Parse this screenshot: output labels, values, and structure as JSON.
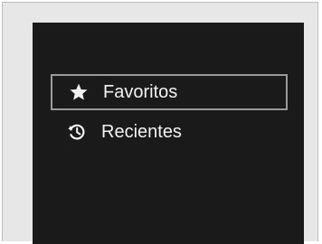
{
  "menu": {
    "items": [
      {
        "label": "Favoritos",
        "icon": "star-icon",
        "selected": true
      },
      {
        "label": "Recientes",
        "icon": "history-clock-icon",
        "selected": false
      }
    ]
  },
  "colors": {
    "screen_background": "#1a1a1a",
    "text": "#f2f2f2",
    "selection_border": "#9a9a9a",
    "frame_background": "#e7e7e7"
  }
}
